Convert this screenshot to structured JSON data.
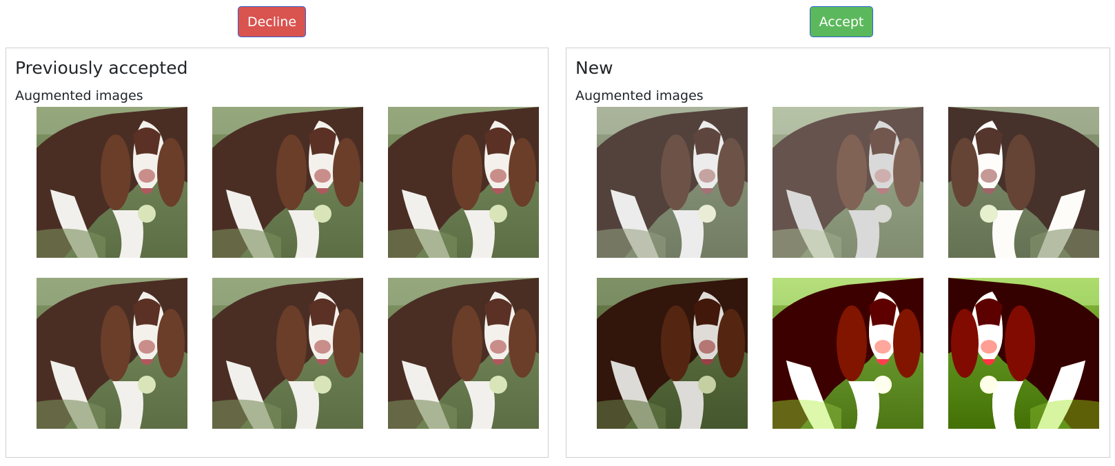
{
  "actions": {
    "decline_label": "Decline",
    "accept_label": "Accept"
  },
  "panels": {
    "previous": {
      "title": "Previously accepted",
      "subtitle": "Augmented images"
    },
    "new": {
      "title": "New",
      "subtitle": "Augmented images"
    }
  },
  "colors": {
    "decline": "#d9534f",
    "accept": "#5cb85c",
    "button_border": "#2b61d6",
    "panel_border": "#cfcfcf"
  },
  "images": {
    "previous": [
      {
        "subject": "springer spaniel with ball",
        "variant": "normal"
      },
      {
        "subject": "springer spaniel with ball",
        "variant": "normal"
      },
      {
        "subject": "springer spaniel with ball",
        "variant": "normal"
      },
      {
        "subject": "springer spaniel with ball",
        "variant": "normal"
      },
      {
        "subject": "springer spaniel with ball",
        "variant": "normal"
      },
      {
        "subject": "springer spaniel with ball",
        "variant": "normal"
      }
    ],
    "new": [
      {
        "subject": "springer spaniel with ball",
        "variant": "washed"
      },
      {
        "subject": "springer spaniel with ball",
        "variant": "bright"
      },
      {
        "subject": "springer spaniel with ball",
        "variant": "flipped-muted"
      },
      {
        "subject": "springer spaniel with ball",
        "variant": "dark"
      },
      {
        "subject": "springer spaniel with ball",
        "variant": "posterized"
      },
      {
        "subject": "springer spaniel with ball",
        "variant": "flipped-posterized"
      }
    ]
  }
}
